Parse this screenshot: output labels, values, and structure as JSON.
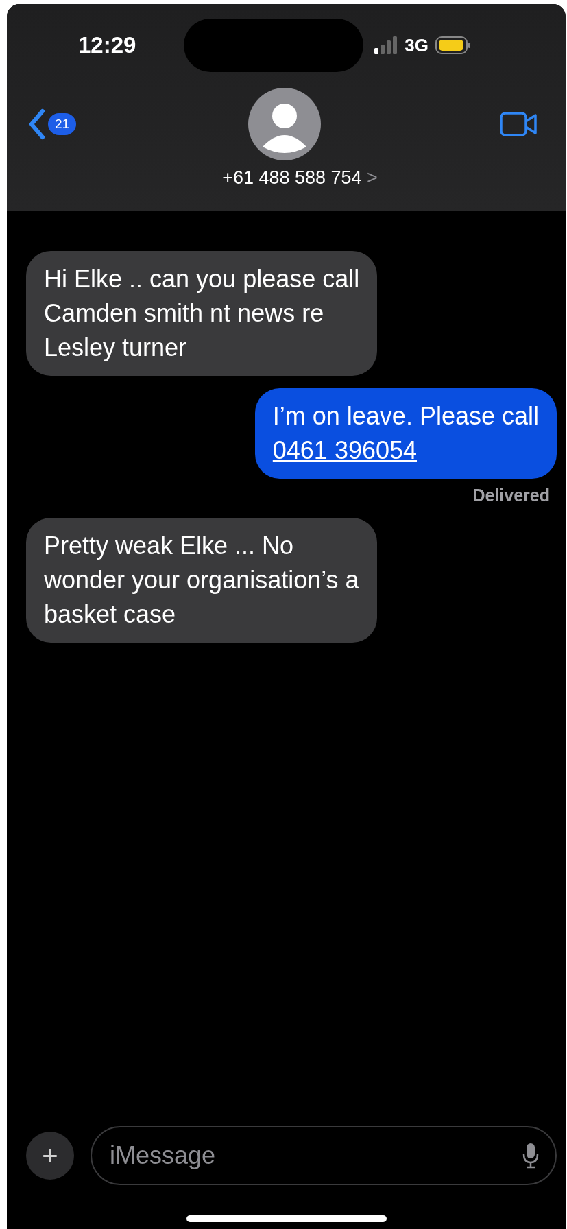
{
  "status_bar": {
    "time": "12:29",
    "network": "3G"
  },
  "nav": {
    "back_count": "21",
    "contact": "+61 488 588 754",
    "chevron": ">"
  },
  "messages": [
    {
      "kind": "received",
      "lines": [
        "Hi Elke .. can you please call",
        "Camden smith nt news re",
        "Lesley turner"
      ]
    },
    {
      "kind": "sent",
      "lines": [
        "I’m on leave. Please call"
      ],
      "link": "0461 396054",
      "status": "Delivered"
    },
    {
      "kind": "received",
      "lines": [
        "Pretty weak Elke ... No",
        "wonder your organisation’s a",
        "basket case"
      ]
    }
  ],
  "composer": {
    "add": "+",
    "placeholder": "iMessage"
  }
}
